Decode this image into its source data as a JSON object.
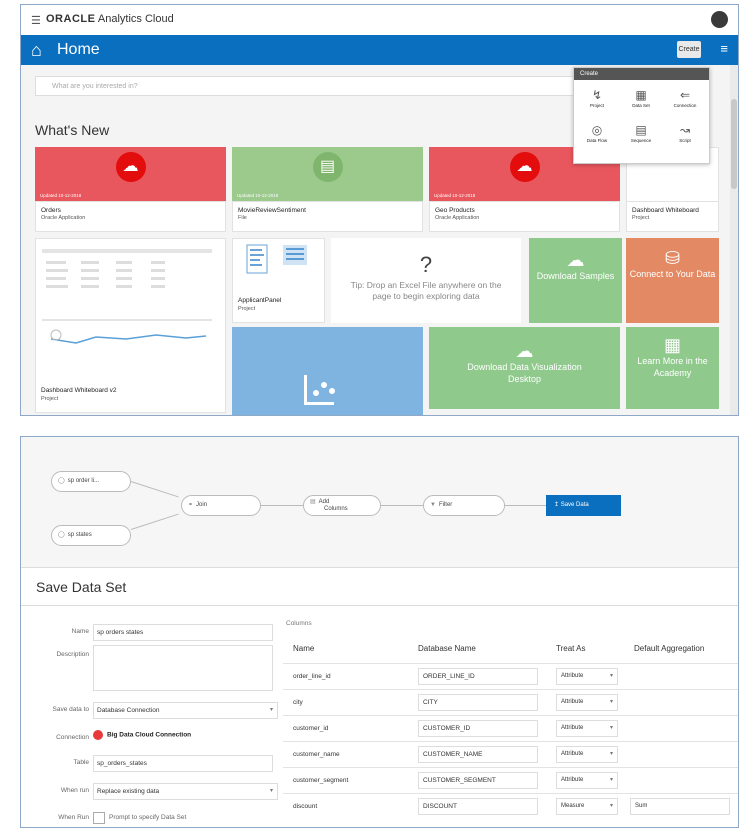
{
  "top": {
    "app_title_brand": "ORACLE",
    "app_title_product": "Analytics Cloud",
    "home_title": "Home",
    "create_button": "Create",
    "search_placeholder": "What are you interested in?",
    "whats_new": "What's New",
    "tiles": [
      {
        "name": "Orders",
        "sub": "Oracle Application",
        "date": "Updated 10-12-2018",
        "color": "#e8575d"
      },
      {
        "name": "MovieReviewSentiment",
        "sub": "File",
        "date": "Updated 10-12-2018",
        "color": "#9cc98c"
      },
      {
        "name": "Geo Products",
        "sub": "Oracle Application",
        "date": "Updated 10-12-2018",
        "color": "#e8575d"
      },
      {
        "name": "Dashboard Whiteboard",
        "sub": "Project",
        "date": "",
        "color": "#ffffff"
      }
    ],
    "project1": {
      "name": "Dashboard Whiteboard v2",
      "sub": "Project"
    },
    "project2": {
      "name": "ApplicantPanel",
      "sub": "Project"
    },
    "tip_mark": "?",
    "tip_text": "Tip: Drop an Excel File anywhere on the page to begin exploring data",
    "download_samples": "Download Samples",
    "connect_data": "Connect to Your Data",
    "download_dv": "Download Data Visualization Desktop",
    "learn_more": "Learn More in the Academy",
    "create_menu": {
      "header": "Create",
      "items": [
        "Project",
        "Data Set",
        "Connection",
        "Data Flow",
        "Sequence",
        "Script"
      ]
    }
  },
  "bottom": {
    "nodes": {
      "source1": "sp order li...",
      "source2": "sp states",
      "join": "Join",
      "add_columns_1": "Add",
      "add_columns_2": "Columns",
      "filter": "Filter",
      "save_data": "Save Data"
    },
    "save_title": "Save Data Set",
    "form": {
      "name_label": "Name",
      "name_value": "sp orders states",
      "desc_label": "Description",
      "save_to_label": "Save data to",
      "save_to_value": "Database Connection",
      "connection_label": "Connection",
      "connection_value": "Big Data Cloud Connection",
      "table_label": "Table",
      "table_value": "sp_orders_states",
      "when_run_label": "When run",
      "when_run_value": "Replace existing data",
      "when_run2_label": "When Run",
      "prompt_label": "Prompt to specify Data Set"
    },
    "columns": {
      "label": "Columns",
      "headers": [
        "Name",
        "Database Name",
        "Treat As",
        "Default Aggregation"
      ],
      "rows": [
        {
          "name": "order_line_id",
          "db": "ORDER_LINE_ID",
          "treat": "Attribute",
          "agg": ""
        },
        {
          "name": "city",
          "db": "CITY",
          "treat": "Attribute",
          "agg": ""
        },
        {
          "name": "customer_id",
          "db": "CUSTOMER_ID",
          "treat": "Attribute",
          "agg": ""
        },
        {
          "name": "customer_name",
          "db": "CUSTOMER_NAME",
          "treat": "Attribute",
          "agg": ""
        },
        {
          "name": "customer_segment",
          "db": "CUSTOMER_SEGMENT",
          "treat": "Attribute",
          "agg": ""
        },
        {
          "name": "discount",
          "db": "DISCOUNT",
          "treat": "Measure",
          "agg": "Sum"
        }
      ]
    }
  }
}
